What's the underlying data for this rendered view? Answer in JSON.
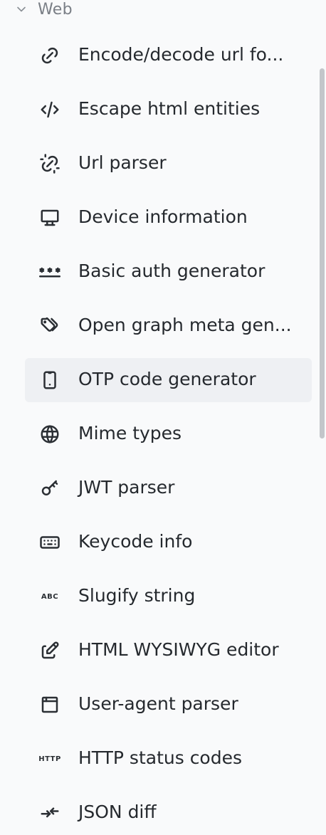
{
  "group": {
    "title": "Web",
    "icon": "chevron-down-icon"
  },
  "items": [
    {
      "label": "Encode/decode url fo...",
      "icon": "link-icon"
    },
    {
      "label": "Escape html entities",
      "icon": "code-icon"
    },
    {
      "label": "Url parser",
      "icon": "unlink-icon"
    },
    {
      "label": "Device information",
      "icon": "monitor-icon"
    },
    {
      "label": "Basic auth generator",
      "icon": "password-icon"
    },
    {
      "label": "Open graph meta gen...",
      "icon": "tags-icon"
    },
    {
      "label": "OTP code generator",
      "icon": "device-mobile-icon",
      "active": true
    },
    {
      "label": "Mime types",
      "icon": "world-icon"
    },
    {
      "label": "JWT parser",
      "icon": "key-icon"
    },
    {
      "label": "Keycode info",
      "icon": "keyboard-icon"
    },
    {
      "label": "Slugify string",
      "icon": "abc-icon",
      "icon_text": "ABC"
    },
    {
      "label": "HTML WYSIWYG editor",
      "icon": "edit-icon"
    },
    {
      "label": "User-agent parser",
      "icon": "browser-icon"
    },
    {
      "label": "HTTP status codes",
      "icon": "http-icon",
      "icon_text": "HTTP"
    },
    {
      "label": "JSON diff",
      "icon": "arrows-compare-icon"
    }
  ],
  "colors": {
    "active_bg": "#eef0f3",
    "text": "#25292e",
    "muted": "#7a7f86"
  }
}
